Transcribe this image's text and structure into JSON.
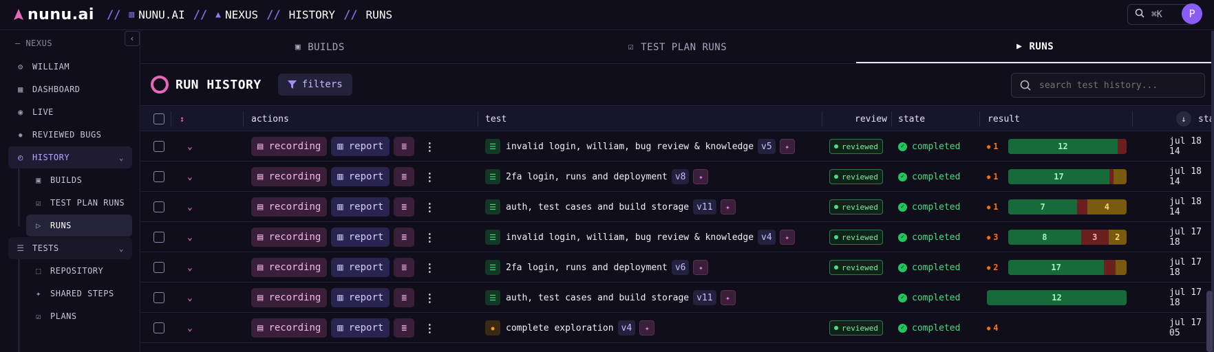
{
  "brand": {
    "name": "nunu.ai"
  },
  "breadcrumbs": [
    {
      "label": "NUNU.AI",
      "icon": "building-icon"
    },
    {
      "label": "NEXUS",
      "icon": "triangle-icon"
    },
    {
      "label": "HISTORY",
      "icon": ""
    },
    {
      "label": "RUNS",
      "icon": ""
    }
  ],
  "crumb_separator": "//",
  "topbar": {
    "shortcut": "⌘K",
    "avatar_initial": "P"
  },
  "sidebar": {
    "project": "— NEXUS",
    "items": [
      {
        "label": "WILLIAM",
        "icon": "bot-icon"
      },
      {
        "label": "DASHBOARD",
        "icon": "grid-icon"
      },
      {
        "label": "LIVE",
        "icon": "broadcast-icon"
      },
      {
        "label": "REVIEWED BUGS",
        "icon": "bug-icon"
      },
      {
        "label": "HISTORY",
        "icon": "history-icon"
      },
      {
        "label": "BUILDS",
        "icon": "box-icon"
      },
      {
        "label": "TEST PLAN RUNS",
        "icon": "checkbox-icon"
      },
      {
        "label": "RUNS",
        "icon": "play-icon"
      },
      {
        "label": "TESTS",
        "icon": "list-icon"
      },
      {
        "label": "REPOSITORY",
        "icon": "layers-icon"
      },
      {
        "label": "SHARED STEPS",
        "icon": "puzzle-icon"
      },
      {
        "label": "PLANS",
        "icon": "checkbox-icon"
      }
    ]
  },
  "tabs": [
    {
      "label": "BUILDS",
      "active": false
    },
    {
      "label": "TEST PLAN RUNS",
      "active": false
    },
    {
      "label": "RUNS",
      "active": true
    }
  ],
  "header": {
    "title": "RUN HISTORY",
    "filters_label": "filters",
    "search_placeholder": "search test history..."
  },
  "columns": {
    "actions": "actions",
    "test": "test",
    "review": "review",
    "state": "state",
    "result": "result",
    "started": "star"
  },
  "labels": {
    "recording": "recording",
    "report": "report",
    "reviewed": "reviewed"
  },
  "rows": [
    {
      "test": "invalid login, william, bug review & knowledge",
      "version": "v5",
      "kind": "list",
      "reviewed": true,
      "state": "completed",
      "bugs": "1",
      "bar": [
        {
          "t": "g",
          "v": 12,
          "label": "12"
        },
        {
          "t": "r",
          "v": 1,
          "label": ""
        }
      ],
      "date": "jul 18 14"
    },
    {
      "test": "2fa login, runs and deployment",
      "version": "v8",
      "kind": "list",
      "reviewed": true,
      "state": "completed",
      "bugs": "1",
      "bar": [
        {
          "t": "g",
          "v": 17,
          "label": "17"
        },
        {
          "t": "r",
          "v": 0.7,
          "label": ""
        },
        {
          "t": "y",
          "v": 2.2,
          "label": ""
        }
      ],
      "date": "jul 18 14"
    },
    {
      "test": "auth, test cases and build storage",
      "version": "v11",
      "kind": "list",
      "reviewed": true,
      "state": "completed",
      "bugs": "1",
      "bar": [
        {
          "t": "g",
          "v": 7,
          "label": "7"
        },
        {
          "t": "r",
          "v": 1,
          "label": ""
        },
        {
          "t": "y",
          "v": 4,
          "label": "4"
        }
      ],
      "date": "jul 18 14"
    },
    {
      "test": "invalid login, william, bug review & knowledge",
      "version": "v4",
      "kind": "list",
      "reviewed": true,
      "state": "completed",
      "bugs": "3",
      "bar": [
        {
          "t": "g",
          "v": 8,
          "label": "8"
        },
        {
          "t": "r",
          "v": 3,
          "label": "3"
        },
        {
          "t": "y",
          "v": 2,
          "label": "2"
        }
      ],
      "date": "jul 17 18"
    },
    {
      "test": "2fa login, runs and deployment",
      "version": "v6",
      "kind": "list",
      "reviewed": true,
      "state": "completed",
      "bugs": "2",
      "bar": [
        {
          "t": "g",
          "v": 17,
          "label": "17"
        },
        {
          "t": "r",
          "v": 2,
          "label": ""
        },
        {
          "t": "y",
          "v": 2,
          "label": ""
        }
      ],
      "date": "jul 17 18"
    },
    {
      "test": "auth, test cases and build storage",
      "version": "v11",
      "kind": "list",
      "reviewed": false,
      "state": "completed",
      "bugs": "",
      "bar": [
        {
          "t": "g",
          "v": 12,
          "label": "12"
        }
      ],
      "date": "jul 17 18"
    },
    {
      "test": "complete exploration",
      "version": "v4",
      "kind": "explore",
      "reviewed": true,
      "state": "completed",
      "bugs": "4",
      "bar": [],
      "date": "jul 17 05"
    }
  ]
}
